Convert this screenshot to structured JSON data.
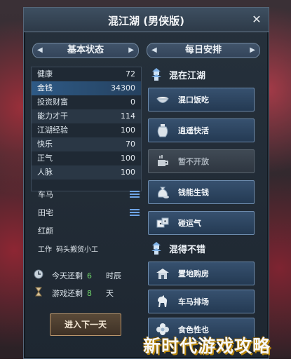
{
  "window": {
    "title": "混江湖 (男侠版)",
    "close_glyph": "✕"
  },
  "left_section": {
    "title": "基本状态"
  },
  "right_section": {
    "title": "每日安排"
  },
  "stats": [
    {
      "label": "健康",
      "value": "72"
    },
    {
      "label": "金钱",
      "value": "34300"
    },
    {
      "label": "投资财富",
      "value": "0"
    },
    {
      "label": "能力才干",
      "value": "114"
    },
    {
      "label": "江湖经验",
      "value": "100"
    },
    {
      "label": "快乐",
      "value": "70"
    },
    {
      "label": "正气",
      "value": "100"
    },
    {
      "label": "人脉",
      "value": "100"
    }
  ],
  "assets": [
    {
      "label": "车马",
      "icon": "list-icon"
    },
    {
      "label": "田宅",
      "icon": "list-icon"
    },
    {
      "label": "红颜"
    }
  ],
  "work": {
    "label": "工作",
    "value": "码头搬货小工"
  },
  "remaining": {
    "today": {
      "label": "今天还剩",
      "value": "6",
      "unit": "时辰",
      "icon": "clock-icon"
    },
    "game": {
      "label": "游戏还剩",
      "value": "8",
      "unit": "天",
      "icon": "hourglass-icon"
    }
  },
  "next_day_button": "进入下一天",
  "groups": [
    {
      "title": "混在江湖",
      "icon": "pagoda-icon",
      "items": [
        {
          "label": "混口饭吃",
          "icon": "rice-bowl-icon",
          "enabled": true
        },
        {
          "label": "逍遥快活",
          "icon": "wine-jar-icon",
          "enabled": true
        },
        {
          "label": "暂不开放",
          "icon": "teacup-icon",
          "enabled": false
        },
        {
          "label": "钱能生钱",
          "icon": "money-pouch-icon",
          "enabled": true
        },
        {
          "label": "碰运气",
          "icon": "dice-icon",
          "enabled": true
        }
      ]
    },
    {
      "title": "混得不错",
      "icon": "pagoda-icon",
      "items": [
        {
          "label": "置地购房",
          "icon": "house-icon",
          "enabled": true
        },
        {
          "label": "车马排场",
          "icon": "horse-icon",
          "enabled": true
        },
        {
          "label": "食色性也",
          "icon": "flower-icon",
          "enabled": true
        }
      ]
    }
  ],
  "watermark": "新时代游戏攻略",
  "colors": {
    "accent_blue": "#6ea4e6",
    "value_green": "#6fd36a",
    "gold": "#b8860b"
  }
}
